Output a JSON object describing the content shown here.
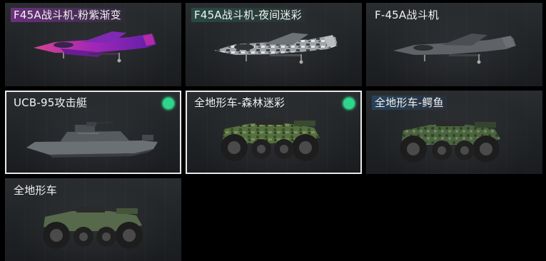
{
  "vehicles": [
    {
      "label": "F45A战斗机-粉紫渐变",
      "icon": "fighter-jet-icon",
      "tag": "purple",
      "equipped": false,
      "selected": false
    },
    {
      "label": "F45A战斗机-夜间迷彩",
      "icon": "fighter-jet-icon",
      "tag": "teal",
      "equipped": false,
      "selected": false
    },
    {
      "label": "F-45A战斗机",
      "icon": "fighter-jet-icon",
      "tag": "none",
      "equipped": false,
      "selected": false
    },
    {
      "label": "UCB-95攻击艇",
      "icon": "attack-boat-icon",
      "tag": "none",
      "equipped": true,
      "selected": true
    },
    {
      "label": "全地形车-森林迷彩",
      "icon": "atv-icon",
      "tag": "none",
      "equipped": true,
      "selected": true
    },
    {
      "label": "全地形车-鳄鱼",
      "icon": "atv-icon",
      "tag": "blue",
      "equipped": false,
      "selected": false
    },
    {
      "label": "全地形车",
      "icon": "atv-icon",
      "tag": "none",
      "equipped": false,
      "selected": false
    }
  ],
  "colors": {
    "equipped_dot": "#2fd58a",
    "selected_border": "#e8e8e8",
    "jet_pink": "#c0389a",
    "jet_night_camo": "#8e9296",
    "jet_plain": "#5a5e62",
    "boat": "#6b7075",
    "atv_forest": "#4f6a3c",
    "atv_crocodile": "#46603a",
    "atv_plain": "#56694a"
  }
}
